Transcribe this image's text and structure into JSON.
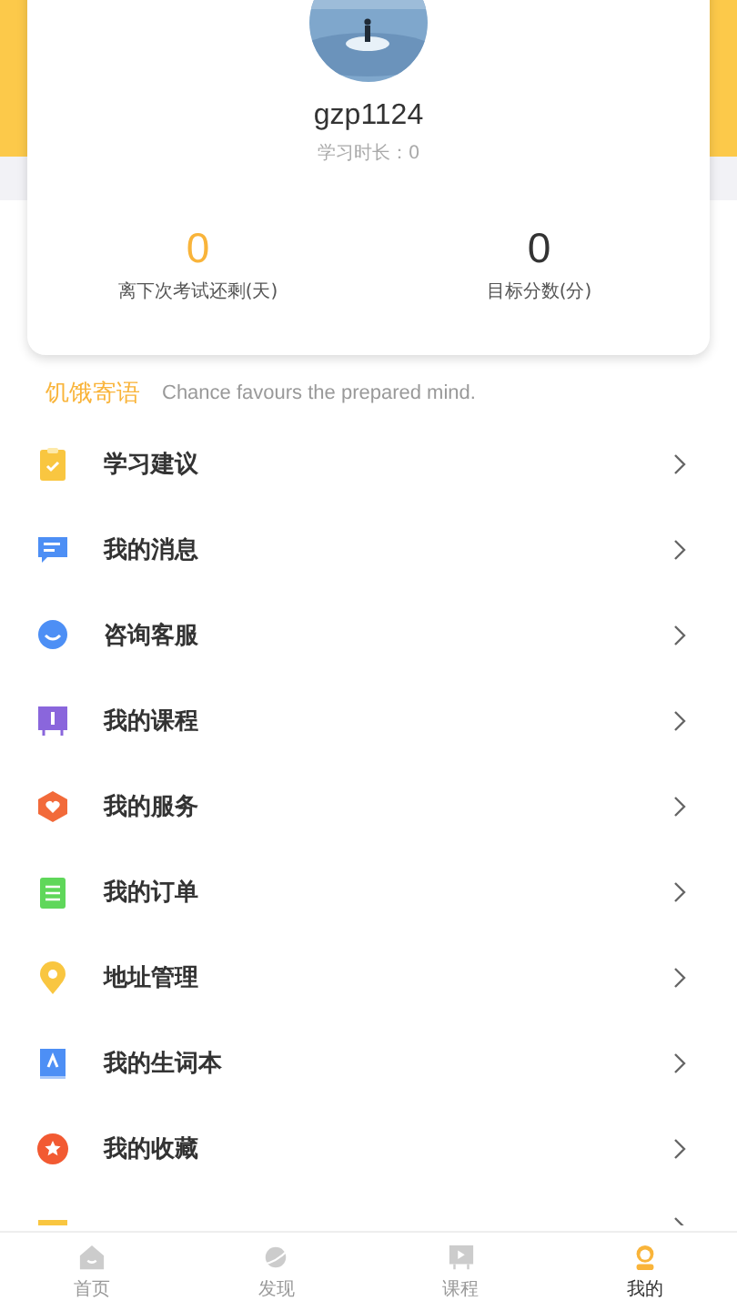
{
  "profile": {
    "username": "gzp1124",
    "study_time": "学习时长：0"
  },
  "stats": [
    {
      "value": "0",
      "label": "离下次考试还剩(天)",
      "highlight": true
    },
    {
      "value": "0",
      "label": "目标分数(分)",
      "highlight": false
    }
  ],
  "motto": {
    "title": "饥饿寄语",
    "text": "Chance favours the prepared mind."
  },
  "menu": [
    {
      "kind": "clipboard",
      "label": "学习建议"
    },
    {
      "kind": "message",
      "label": "我的消息"
    },
    {
      "kind": "service",
      "label": "咨询客服"
    },
    {
      "kind": "course",
      "label": "我的课程"
    },
    {
      "kind": "shield",
      "label": "我的服务"
    },
    {
      "kind": "order",
      "label": "我的订单"
    },
    {
      "kind": "location",
      "label": "地址管理"
    },
    {
      "kind": "book",
      "label": "我的生词本"
    },
    {
      "kind": "star",
      "label": "我的收藏"
    },
    {
      "kind": "coupon"
    }
  ],
  "tabs": [
    {
      "kind": "home",
      "label": "首页",
      "selected": false
    },
    {
      "kind": "discover",
      "label": "发现",
      "selected": false
    },
    {
      "kind": "course",
      "label": "课程",
      "selected": false
    },
    {
      "kind": "me",
      "label": "我的",
      "selected": true
    }
  ]
}
